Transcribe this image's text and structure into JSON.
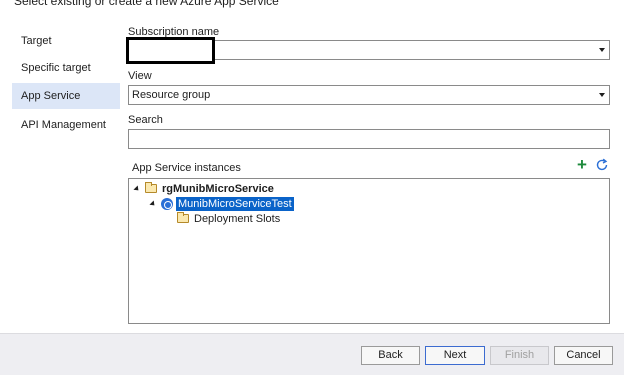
{
  "dialog": {
    "title": "Select existing or create a new Azure App Service"
  },
  "nav": {
    "items": [
      {
        "label": "Target",
        "selected": false
      },
      {
        "label": "Specific target",
        "selected": false
      },
      {
        "label": "App Service",
        "selected": true
      },
      {
        "label": "API Management",
        "selected": false
      }
    ]
  },
  "form": {
    "subscription_label": "Subscription name",
    "subscription_value": "",
    "view_label": "View",
    "view_value": "Resource group",
    "search_label": "Search",
    "search_value": ""
  },
  "instances": {
    "label": "App Service instances",
    "resource_group": "rgMunibMicroService",
    "app_service": "MunibMicroServiceTest",
    "slots": "Deployment Slots"
  },
  "buttons": {
    "back": "Back",
    "next": "Next",
    "finish": "Finish",
    "cancel": "Cancel"
  },
  "icons": {
    "add": "add-icon",
    "refresh": "refresh-icon"
  }
}
